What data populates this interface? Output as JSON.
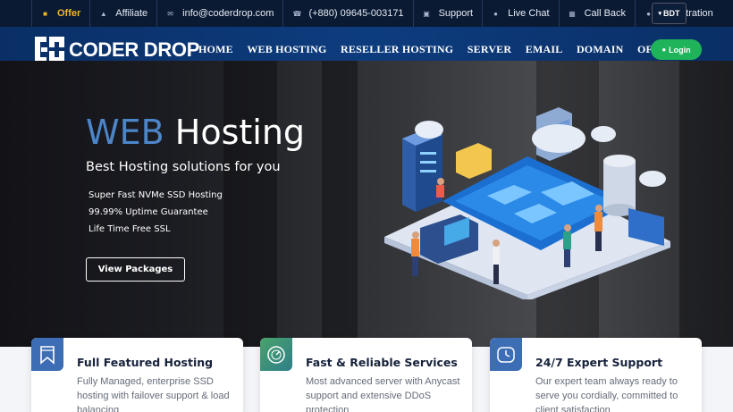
{
  "topbar": {
    "items": [
      {
        "label": "Offer",
        "icon": "gift-icon"
      },
      {
        "label": "Affiliate",
        "icon": "trophy-icon"
      },
      {
        "label": "info@coderdrop.com",
        "icon": "envelope-icon"
      },
      {
        "label": "(+880) 09645-003171",
        "icon": "phone-icon"
      },
      {
        "label": "Support",
        "icon": "inbox-icon"
      },
      {
        "label": "Live Chat",
        "icon": "chat-icon"
      },
      {
        "label": "Call Back",
        "icon": "calendar-icon"
      },
      {
        "label": "Registration",
        "icon": "user-plus-icon"
      }
    ],
    "currency": "BDT"
  },
  "brand": {
    "name": "CODER DROP"
  },
  "nav": {
    "items": [
      "HOME",
      "WEB HOSTING",
      "RESELLER HOSTING",
      "SERVER",
      "EMAIL",
      "DOMAIN",
      "OFFERS"
    ],
    "login_label": "Login"
  },
  "hero": {
    "title_accent": "WEB",
    "title_rest": "Hosting",
    "subtitle": "Best Hosting solutions for you",
    "features": [
      "Super Fast NVMe SSD Hosting",
      "99.99% Uptime Guarantee",
      "Life Time Free SSL"
    ],
    "cta_label": "View Packages"
  },
  "cards": [
    {
      "title": "Full Featured Hosting",
      "desc": "Fully Managed, enterprise SSD hosting with failover support & load balancing",
      "icon": "bookmark-icon"
    },
    {
      "title": "Fast & Reliable Services",
      "desc": "Most advanced server with Anycast support and extensive DDoS protection",
      "icon": "speedometer-icon"
    },
    {
      "title": "24/7 Expert Support",
      "desc": "Our expert team always ready to serve you cordially, committed to client satisfaction",
      "icon": "clock-icon"
    }
  ],
  "colors": {
    "topbar": "#0a1a33",
    "nav": "#0d3c7e",
    "accent_blue": "#4c86c9",
    "offer": "#f1b624",
    "login": "#1fb35a"
  }
}
